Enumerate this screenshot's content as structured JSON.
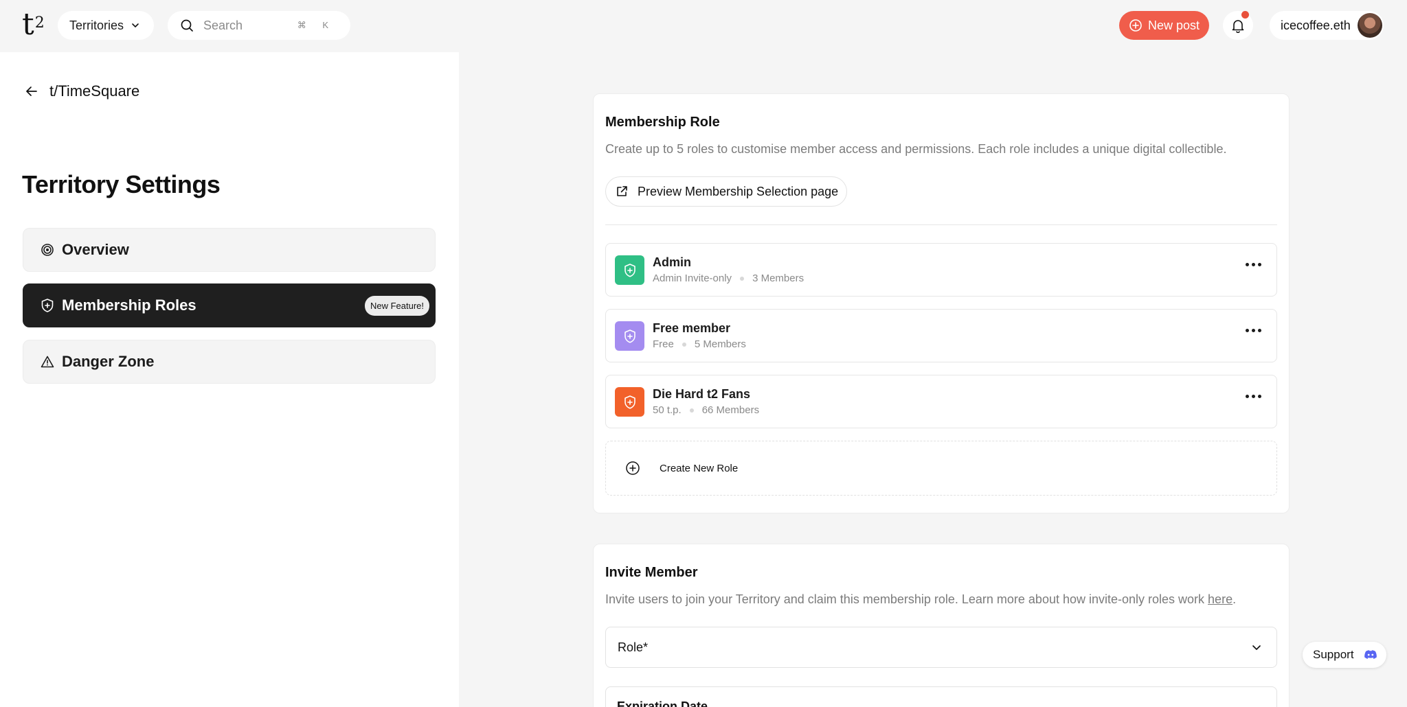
{
  "header": {
    "logo": "t",
    "logo_sup": "2",
    "territories_label": "Territories",
    "search_placeholder": "Search",
    "search_shortcut": "⌘ K",
    "new_post_label": "New post",
    "username": "icecoffee.eth"
  },
  "sidebar": {
    "back_label": "t/TimeSquare",
    "title": "Territory Settings",
    "items": [
      {
        "label": "Overview",
        "icon": "target-icon"
      },
      {
        "label": "Membership Roles",
        "icon": "shield-icon",
        "badge": "New Feature!",
        "active": true
      },
      {
        "label": "Danger Zone",
        "icon": "warning-icon"
      }
    ]
  },
  "membership": {
    "title": "Membership Role",
    "description": "Create up to 5 roles to customise member access and permissions. Each role includes a unique digital collectible.",
    "preview_label": "Preview Membership Selection page",
    "roles": [
      {
        "name": "Admin",
        "access": "Admin Invite-only",
        "members": "3 Members",
        "color": "#2fbf85"
      },
      {
        "name": "Free member",
        "access": "Free",
        "members": "5 Members",
        "color": "#a48cf0"
      },
      {
        "name": "Die Hard t2 Fans",
        "access": "50 t.p.",
        "members": "66 Members",
        "color": "#f2612a"
      }
    ],
    "create_label": "Create New Role"
  },
  "invite": {
    "title": "Invite Member",
    "description_prefix": "Invite users to join your Territory and claim this membership role. Learn more about how invite-only roles work ",
    "description_link": "here",
    "description_suffix": ".",
    "role_placeholder": "Role*",
    "expiration_label": "Expiration Date"
  },
  "support_label": "Support",
  "colors": {
    "accent": "#f05d4b",
    "active_nav": "#1f1f1f",
    "notification_dot": "#e8503b"
  }
}
